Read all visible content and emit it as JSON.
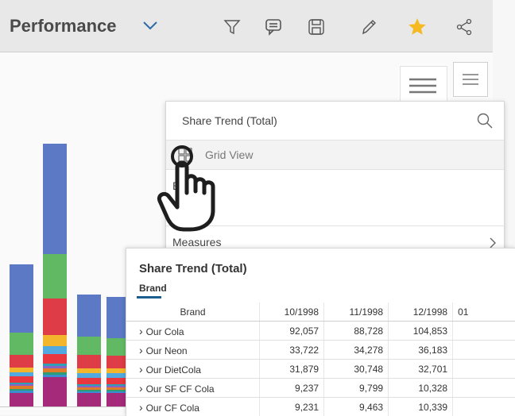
{
  "header": {
    "title": "Performance",
    "icons": [
      "chevron-down-icon",
      "filter-icon",
      "comment-icon",
      "save-icon",
      "edit-icon",
      "star-icon",
      "share-icon"
    ],
    "star_color": "#f5b921"
  },
  "popup_menu": {
    "title": "Share Trend (Total)",
    "grid_view_label": "Grid View",
    "partial_item": "B",
    "measures_label": "Measures"
  },
  "grid_panel": {
    "title": "Share Trend (Total)",
    "tab_label": "Brand",
    "columns": [
      "Brand",
      "10/1998",
      "11/1998",
      "12/1998",
      "01"
    ],
    "rows": [
      {
        "brand": "Our Cola",
        "v1": "92,057",
        "v2": "88,728",
        "v3": "104,853"
      },
      {
        "brand": "Our Neon",
        "v1": "33,722",
        "v2": "34,278",
        "v3": "36,183"
      },
      {
        "brand": "Our DietCola",
        "v1": "31,879",
        "v2": "30,748",
        "v3": "32,701"
      },
      {
        "brand": "Our SF CF Cola",
        "v1": "9,237",
        "v2": "9,799",
        "v3": "10,328"
      },
      {
        "brand": "Our CF Cola",
        "v1": "9,231",
        "v2": "9,463",
        "v3": "10,339"
      }
    ]
  },
  "chart_data": {
    "type": "bar",
    "stacked": true,
    "series_colors": [
      "#a52a7a",
      "#3a8fd1",
      "#2e9d74",
      "#e07b2a",
      "#8a63c4",
      "#2f9fb5",
      "#e8373f",
      "#52a9e0",
      "#f2b52b",
      "#de3c46",
      "#61b964",
      "#5b79c4"
    ],
    "bars": [
      [
        18,
        3,
        2,
        4,
        2,
        2,
        8,
        5,
        6,
        16,
        28,
        86
      ],
      [
        38,
        3,
        3,
        5,
        3,
        3,
        12,
        10,
        14,
        46,
        56,
        139
      ],
      [
        18,
        2,
        2,
        3,
        2,
        2,
        8,
        6,
        6,
        17,
        23,
        53
      ],
      [
        18,
        2,
        2,
        3,
        2,
        2,
        8,
        6,
        6,
        16,
        22,
        52
      ]
    ]
  }
}
